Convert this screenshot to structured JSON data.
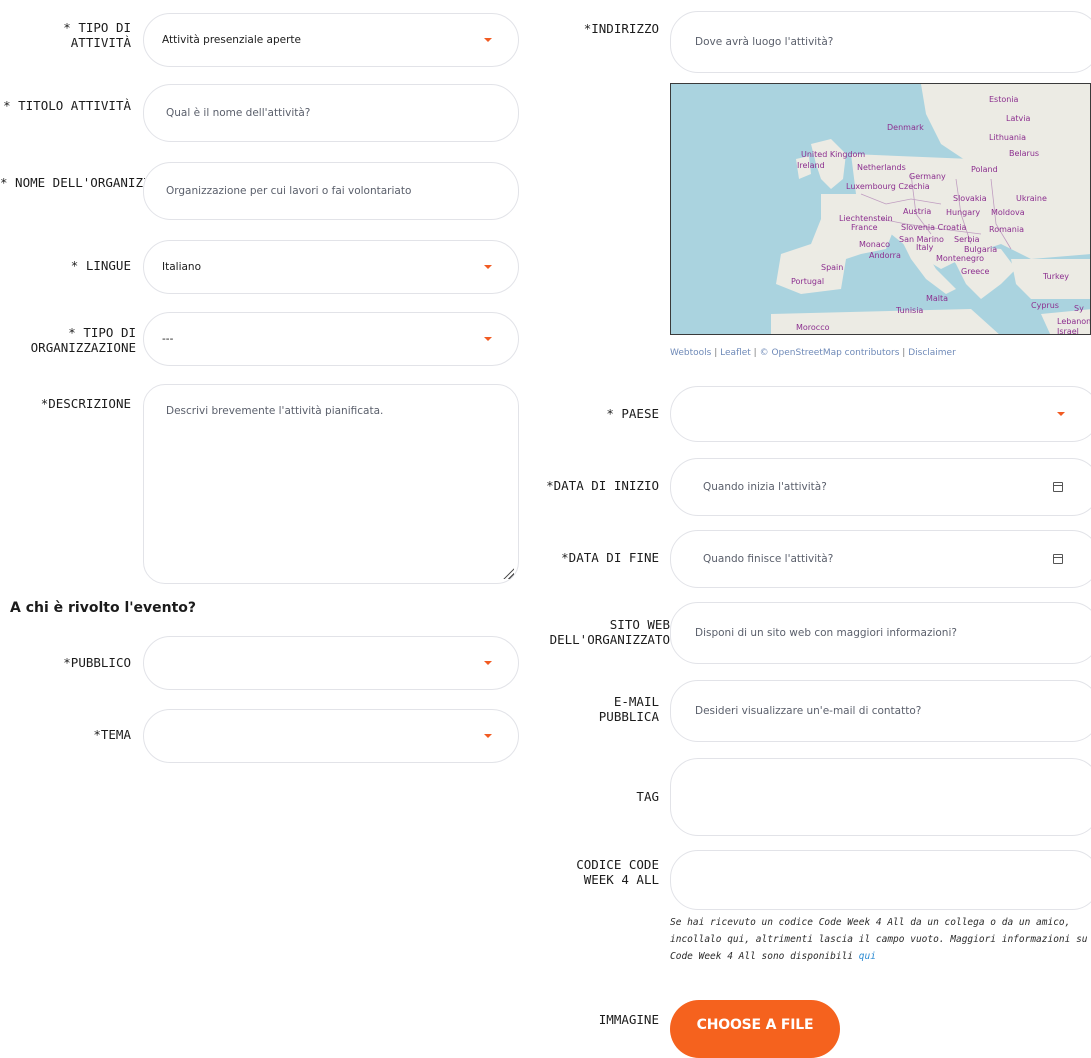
{
  "left": {
    "tipo_attivita": {
      "label": "* TIPO DI ATTIVITÀ",
      "value": "Attività presenziale aperte"
    },
    "titolo": {
      "label": "* TITOLO ATTIVITÀ",
      "placeholder": "Qual è il nome dell'attività?"
    },
    "organizzazione": {
      "label": "* NOME DELL'ORGANIZZAZI",
      "placeholder": "Organizzazione per cui lavori o fai volontariato"
    },
    "lingue": {
      "label": "* LINGUE",
      "value": "Italiano"
    },
    "tipo_org": {
      "label": "* TIPO DI ORGANIZZAZIONE",
      "value": "---"
    },
    "descrizione": {
      "label": "*DESCRIZIONE",
      "placeholder": "Descrivi brevemente l'attività pianificata."
    },
    "section_title": "A chi è rivolto l'evento?",
    "pubblico": {
      "label": "*PUBBLICO",
      "value": ""
    },
    "tema": {
      "label": "*TEMA",
      "value": ""
    }
  },
  "right": {
    "indirizzo": {
      "label": "*INDIRIZZO",
      "placeholder": "Dove avrà luogo l'attività?"
    },
    "map_attribution": {
      "webtools": "Webtools",
      "leaflet": "Leaflet",
      "osm": "© OpenStreetMap contributors",
      "disclaimer": "Disclaimer"
    },
    "map_labels": [
      "Estonia",
      "Latvia",
      "Denmark",
      "Lithuania",
      "Belarus",
      "United Kingdom",
      "Ireland",
      "Netherlands",
      "Germany",
      "Poland",
      "Luxembourg",
      "Czechia",
      "Slovakia",
      "Ukraine",
      "Austria",
      "Hungary",
      "Moldova",
      "Liechtenstein",
      "France",
      "Slovenia",
      "Croatia",
      "Romania",
      "San Marino",
      "Serbia",
      "Monaco",
      "Italy",
      "Bulgaria",
      "Andorra",
      "Montenegro",
      "Spain",
      "Portugal",
      "Greece",
      "Turkey",
      "Malta",
      "Tunisia",
      "Cyprus",
      "Lebanon",
      "Israel",
      "Morocco",
      "Sy"
    ],
    "paese": {
      "label": "* PAESE",
      "value": ""
    },
    "data_inizio": {
      "label": "*DATA DI INIZIO",
      "placeholder": "Quando inizia l'attività?"
    },
    "data_fine": {
      "label": "*DATA DI FINE",
      "placeholder": "Quando finisce l'attività?"
    },
    "sito_web": {
      "label": "SITO WEB DELL'ORGANIZZATO",
      "placeholder": "Disponi di un sito web con maggiori informazioni?"
    },
    "email": {
      "label": "E-MAIL PUBBLICA",
      "placeholder": "Desideri visualizzare un'e-mail di contatto?"
    },
    "tag": {
      "label": "TAG",
      "value": ""
    },
    "codice": {
      "label": "CODICE CODE WEEK 4 ALL",
      "value": ""
    },
    "codice_hint": "Se hai ricevuto un codice Code Week 4 All da un collega o da un amico, incollalo qui, altrimenti lascia il campo vuoto. Maggiori informazioni su Code Week 4 All sono disponibili",
    "codice_hint_link": "qui",
    "immagine": {
      "label": "IMMAGINE",
      "button": "CHOOSE A FILE"
    }
  }
}
